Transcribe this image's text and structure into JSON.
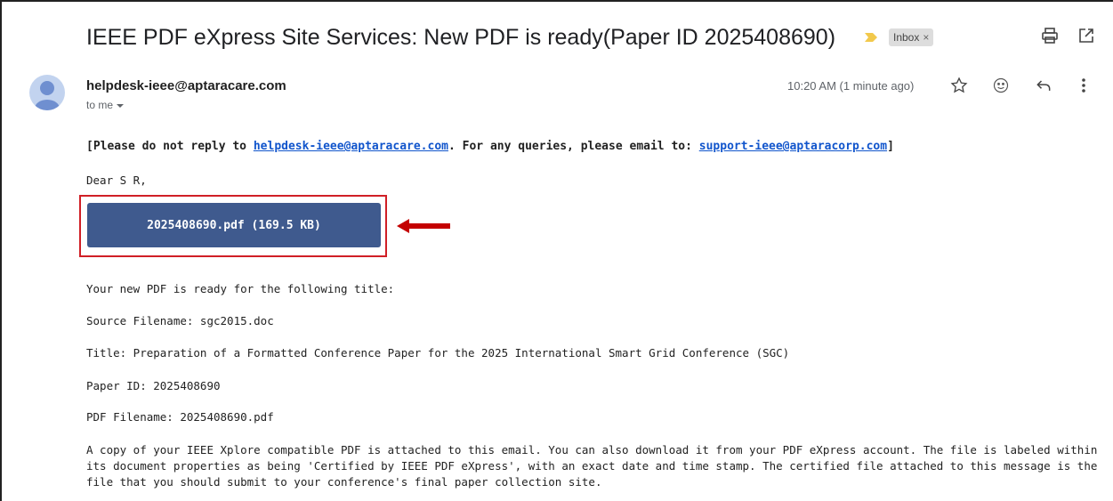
{
  "email": {
    "subject": "IEEE PDF eXpress Site Services: New PDF is ready(Paper ID 2025408690)",
    "label": "Inbox",
    "label_close": "×",
    "sender": "helpdesk-ieee@aptaracare.com",
    "recipient": "to me",
    "time": "10:20 AM (1 minute ago)"
  },
  "body": {
    "notice_prefix": "[Please do not reply to ",
    "notice_link1": "helpdesk-ieee@aptaracare.com",
    "notice_mid": ". For any queries, please email to: ",
    "notice_link2": "support-ieee@aptaracorp.com",
    "notice_suffix": "]",
    "greeting": "Dear S R,",
    "attachment_button": "2025408690.pdf (169.5 KB)",
    "line1": "Your new PDF is ready for the following title:",
    "line2": "Source Filename: sgc2015.doc",
    "line3": "Title: Preparation of a Formatted Conference Paper for the 2025 International Smart Grid Conference (SGC)",
    "line4": "Paper ID: 2025408690",
    "line5": "PDF Filename: 2025408690.pdf",
    "paragraph": "A copy of your IEEE Xplore compatible PDF is attached to this email. You can also download it from your PDF eXpress account. The file is labeled within its document properties as being 'Certified by IEEE PDF eXpress', with an exact date and time stamp. The certified file attached to this message is the file that you should submit to your conference's final paper collection site."
  },
  "icons": {
    "importance": "importance-marker-icon",
    "print": "print-icon",
    "new_window": "open-new-window-icon",
    "star": "star-icon",
    "emoji": "emoji-icon",
    "reply": "reply-icon",
    "more": "more-vertical-icon",
    "annotation": "red-arrow-icon"
  },
  "colors": {
    "button": "#3f5a8e",
    "highlight": "#d01f26",
    "link": "#1155cc",
    "importance": "#f2c94c"
  }
}
